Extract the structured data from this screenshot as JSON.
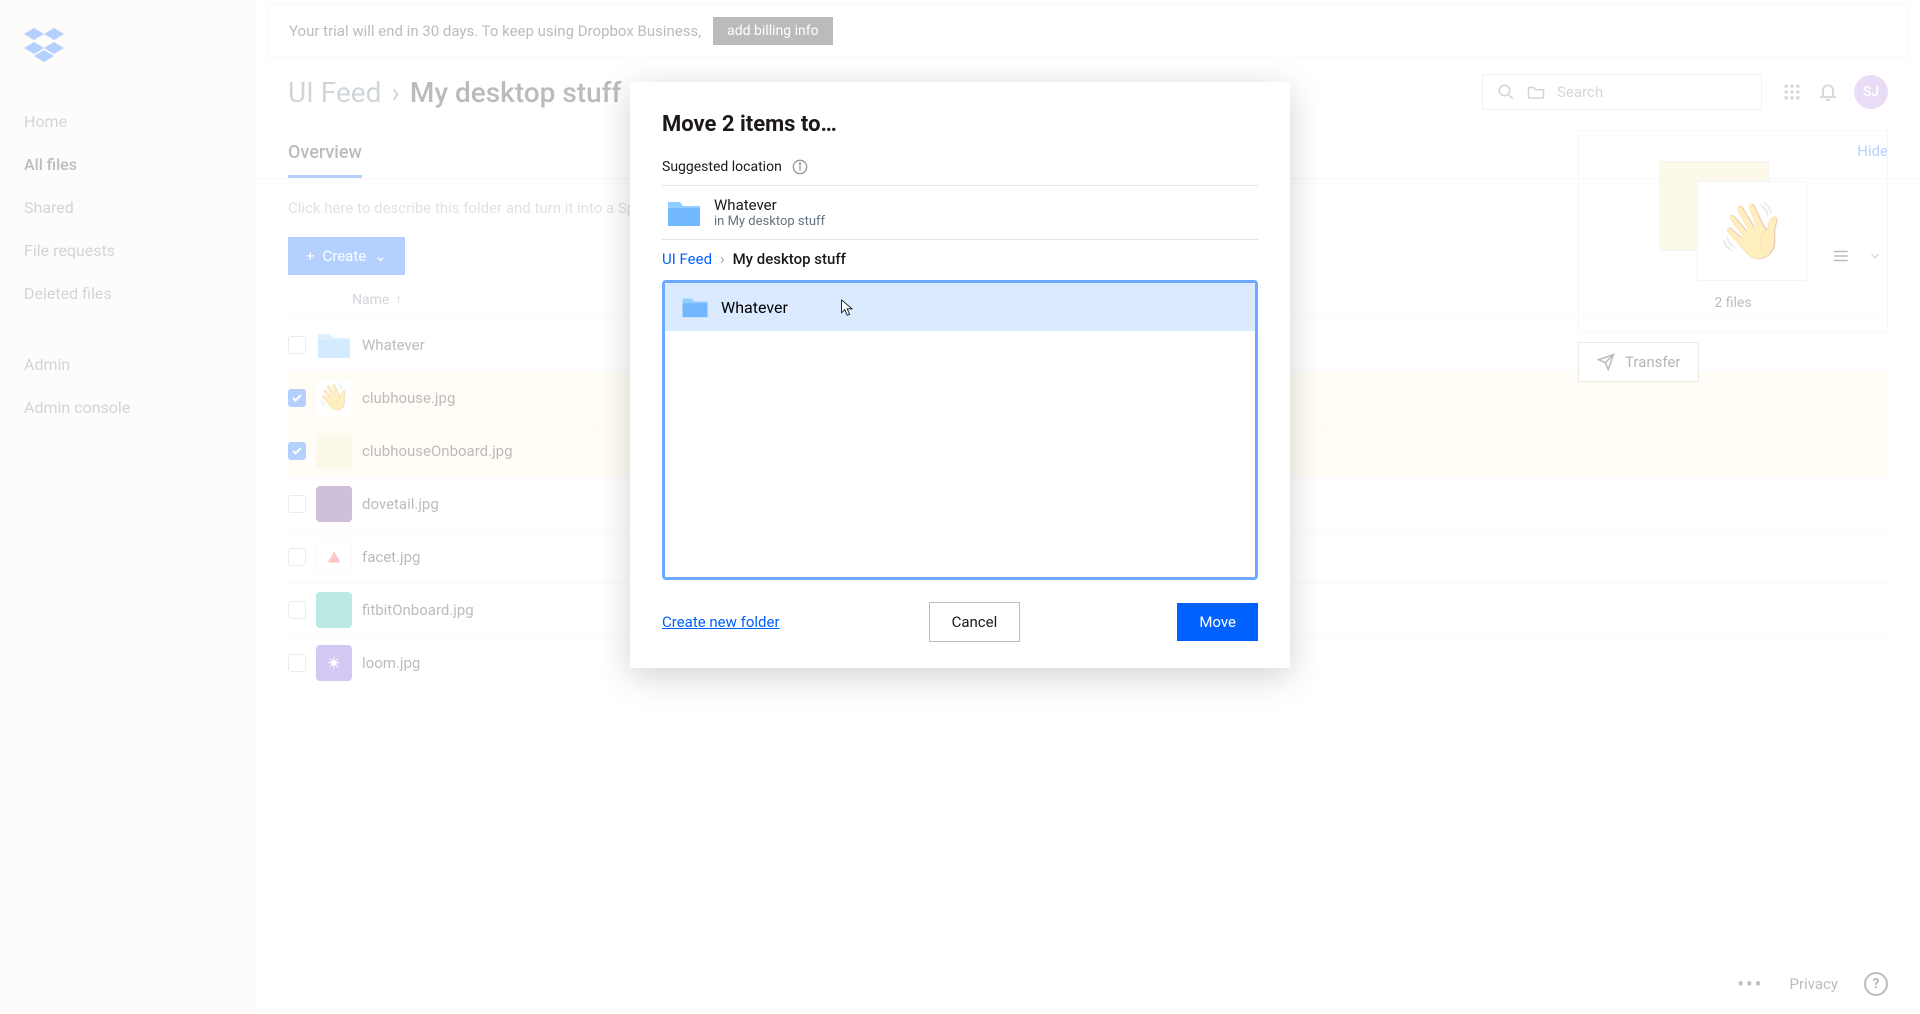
{
  "banner": {
    "message": "Your trial will end in 30 days. To keep using Dropbox Business,",
    "cta": "add billing info"
  },
  "sidebar": {
    "items": [
      {
        "label": "Home"
      },
      {
        "label": "All files"
      },
      {
        "label": "Shared"
      },
      {
        "label": "File requests"
      },
      {
        "label": "Deleted files"
      }
    ],
    "admin_items": [
      {
        "label": "Admin"
      },
      {
        "label": "Admin console"
      }
    ]
  },
  "breadcrumb": {
    "parent": "UI Feed",
    "current": "My desktop stuff"
  },
  "search": {
    "placeholder": "Search"
  },
  "avatar": "SJ",
  "tab": "Overview",
  "hide": "Hide",
  "description_placeholder": "Click here to describe this folder and turn it into a Space",
  "create_label": "Create",
  "table": {
    "name_header": "Name"
  },
  "files": [
    {
      "name": "Whatever",
      "type": "folder",
      "selected": false
    },
    {
      "name": "clubhouse.jpg",
      "type": "image",
      "selected": true,
      "emoji": "👋"
    },
    {
      "name": "clubhouseOnboard.jpg",
      "type": "image",
      "selected": true,
      "bg": "#f5e6b8"
    },
    {
      "name": "dovetail.jpg",
      "type": "image",
      "selected": false,
      "bg": "#5b2a86"
    },
    {
      "name": "facet.jpg",
      "type": "image",
      "selected": false,
      "bg": "#fff"
    },
    {
      "name": "fitbitOnboard.jpg",
      "type": "image",
      "selected": false,
      "bg": "#1db5a0"
    },
    {
      "name": "loom.jpg",
      "type": "image",
      "selected": false,
      "bg": "#6c47d6"
    }
  ],
  "right_panel": {
    "count_label": "2 files",
    "transfer": "Transfer"
  },
  "modal": {
    "title": "Move 2 items to…",
    "suggested_label": "Suggested location",
    "suggested": {
      "name": "Whatever",
      "path": "in My desktop stuff"
    },
    "crumb": {
      "root": "UI Feed",
      "current": "My desktop stuff"
    },
    "browser_folder": "Whatever",
    "create_folder": "Create new folder",
    "cancel": "Cancel",
    "move": "Move"
  },
  "footer": {
    "privacy": "Privacy"
  }
}
